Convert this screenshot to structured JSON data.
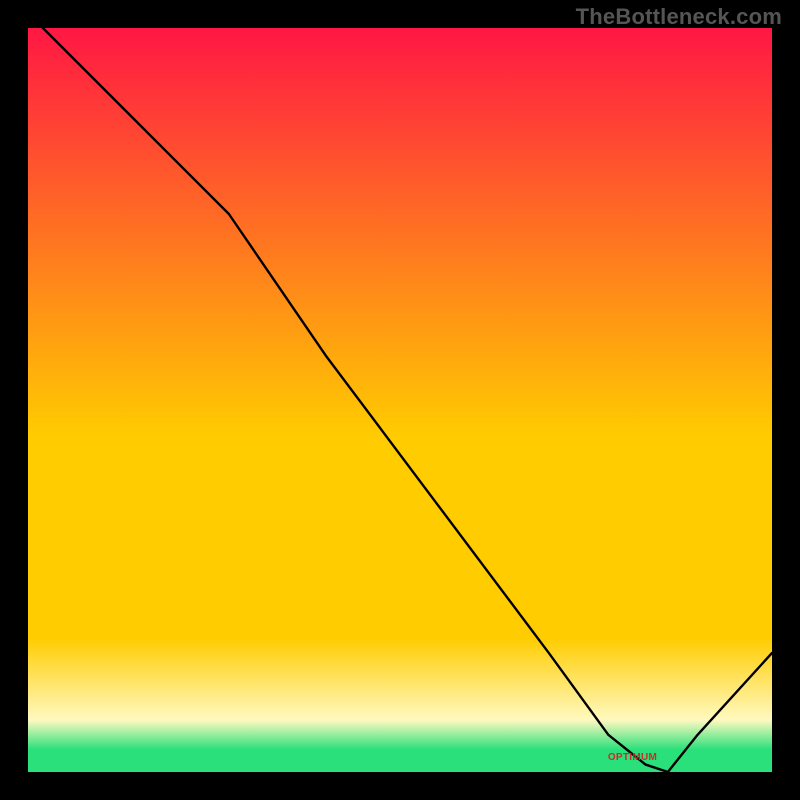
{
  "watermark": "TheBottleneck.com",
  "marker": {
    "label": "OPTIMUM"
  },
  "colors": {
    "top": "#ff1744",
    "mid": "#ffcc00",
    "cream": "#fff9c0",
    "green": "#29e07a",
    "line": "#000000"
  },
  "chart_data": {
    "type": "line",
    "title": "",
    "xlabel": "",
    "ylabel": "",
    "xlim": [
      0,
      100
    ],
    "ylim": [
      0,
      100
    ],
    "series": [
      {
        "name": "curve",
        "x": [
          2,
          10,
          20,
          27,
          40,
          55,
          70,
          78,
          83,
          86,
          90,
          100
        ],
        "values": [
          100,
          92,
          82,
          75,
          56,
          36,
          16,
          5,
          1,
          0,
          5,
          16
        ]
      }
    ],
    "optimum_x": 86,
    "gradient_stops_pct": [
      0,
      55,
      82,
      93,
      97,
      100
    ]
  }
}
